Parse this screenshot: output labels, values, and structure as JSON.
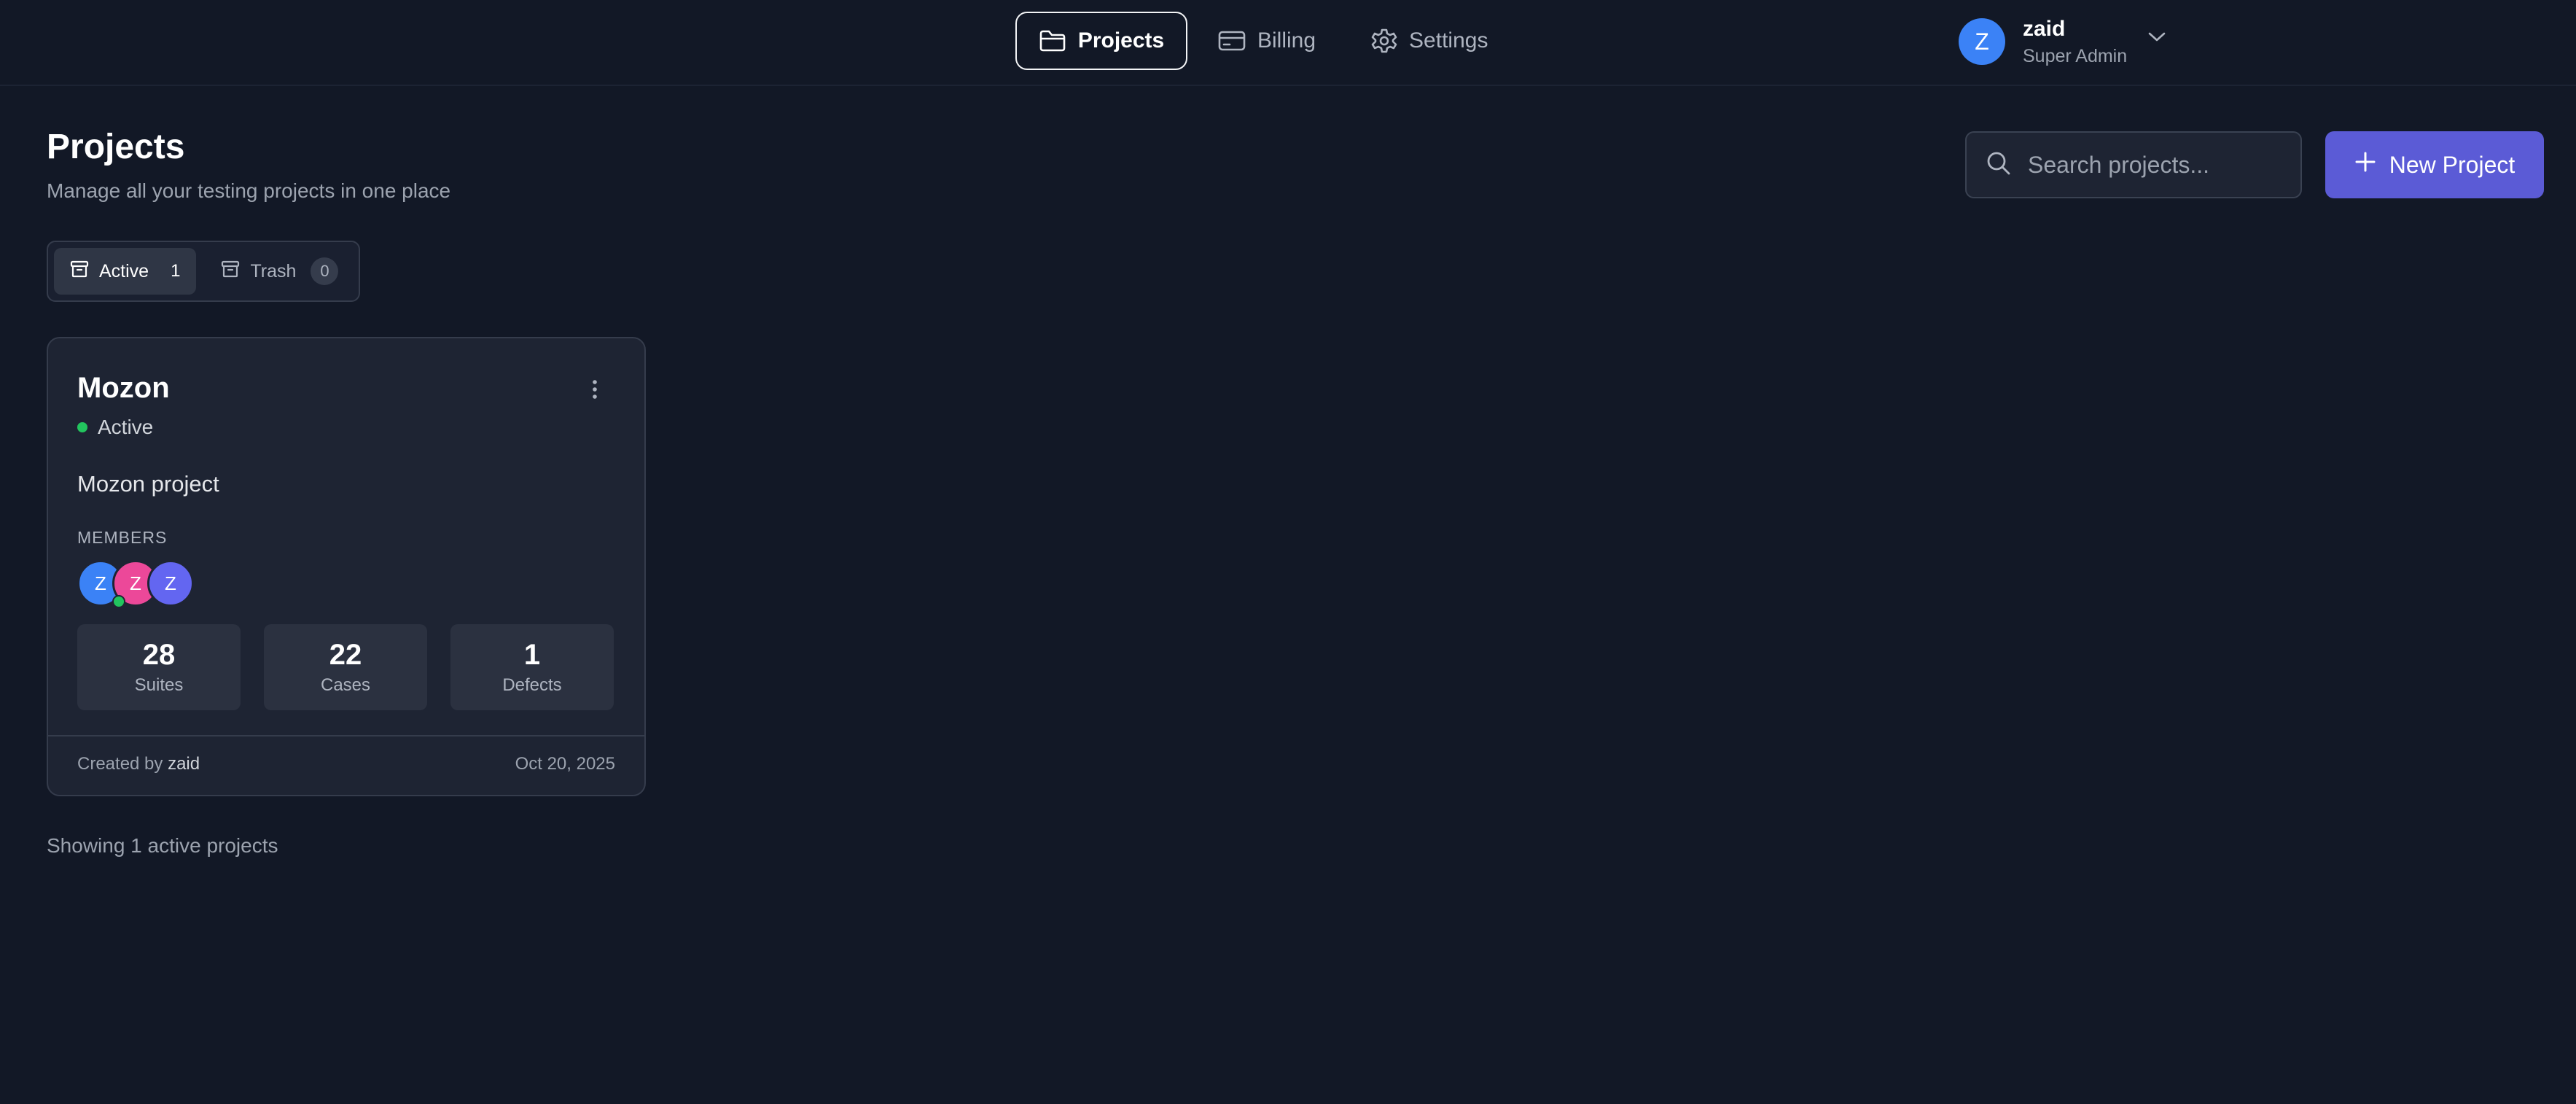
{
  "colors": {
    "background": "#121826",
    "card": "#1e2433",
    "accent": "#5b5bd6",
    "status_active": "#22c55e",
    "avatar_blue": "#3b82f6",
    "avatar_pink": "#ec4899",
    "avatar_indigo": "#6366f1"
  },
  "nav": {
    "items": [
      {
        "label": "Projects",
        "icon": "folder-icon",
        "active": true
      },
      {
        "label": "Billing",
        "icon": "credit-card-icon",
        "active": false
      },
      {
        "label": "Settings",
        "icon": "gear-icon",
        "active": false
      }
    ]
  },
  "user": {
    "initial": "Z",
    "name": "zaid",
    "role": "Super Admin",
    "menu_icon": "chevron-down-icon"
  },
  "header": {
    "title": "Projects",
    "subtitle": "Manage all your testing projects in one place"
  },
  "search": {
    "placeholder": "Search projects...",
    "value": "",
    "icon": "search-icon"
  },
  "new_project_button": {
    "label": "New Project",
    "icon": "plus-icon"
  },
  "tabs": [
    {
      "label": "Active",
      "count": "1",
      "icon": "archive-icon",
      "active": true
    },
    {
      "label": "Trash",
      "count": "0",
      "icon": "trash-box-icon",
      "active": false
    }
  ],
  "project": {
    "name": "Mozon",
    "status": "Active",
    "description": "Mozon project",
    "members_label": "MEMBERS",
    "members": [
      {
        "initial": "Z",
        "color": "#3b82f6"
      },
      {
        "initial": "Z",
        "color": "#ec4899"
      },
      {
        "initial": "Z",
        "color": "#6366f1"
      }
    ],
    "stats": [
      {
        "value": "28",
        "label": "Suites"
      },
      {
        "value": "22",
        "label": "Cases"
      },
      {
        "value": "1",
        "label": "Defects"
      }
    ],
    "created_prefix": "Created by",
    "created_by": "zaid",
    "created_date": "Oct 20, 2025",
    "menu_icon": "more-vertical-icon"
  },
  "footer": {
    "showing_text": "Showing 1 active projects"
  }
}
